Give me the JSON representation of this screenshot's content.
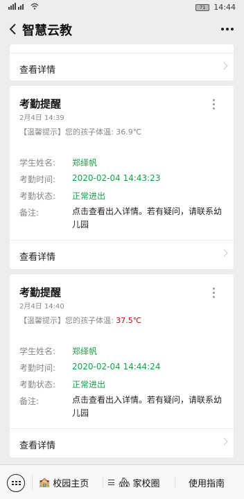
{
  "statusbar": {
    "signal": "ᴪᴴ•••·••",
    "wifi": "≈",
    "battery": "71",
    "time": "14:44"
  },
  "header": {
    "title": "智慧云教"
  },
  "cards": [
    {
      "detail_label": "查看详情"
    },
    {
      "title": "考勤提醒",
      "date": "2月4日  14:39",
      "tip_prefix": "【温馨提示】您的孩子体温:",
      "temp": "36.9℃",
      "name_label": "学生姓名:",
      "name": "郑绎帆",
      "time_label": "考勤时间:",
      "time": "2020-02-04 14:43:23",
      "status_label": "考勤状态:",
      "status": "正常进出",
      "remark_label": "备注:",
      "remark": "点击查看出入详情。若有疑问，请联系幼儿园",
      "detail_label": "查看详情"
    },
    {
      "title": "考勤提醒",
      "date": "2月4日  14:40",
      "tip_prefix": "【温馨提示】您的孩子体温:",
      "temp": "37.5℃",
      "name_label": "学生姓名:",
      "name": "郑绎帆",
      "time_label": "考勤时间:",
      "time": "2020-02-04 14:44:24",
      "status_label": "考勤状态:",
      "status": "正常进出",
      "remark_label": "备注:",
      "remark": "点击查看出入详情。若有疑问，请联系幼儿园",
      "detail_label": "查看详情"
    }
  ],
  "bottom_menu": [
    {
      "label": "校园主页",
      "icon": "school-icon"
    },
    {
      "label": "家校圈",
      "icon": "community-icon"
    },
    {
      "label": "使用指南"
    }
  ],
  "colors": {
    "green": "#18a048",
    "warning_red": "#d0021b"
  }
}
